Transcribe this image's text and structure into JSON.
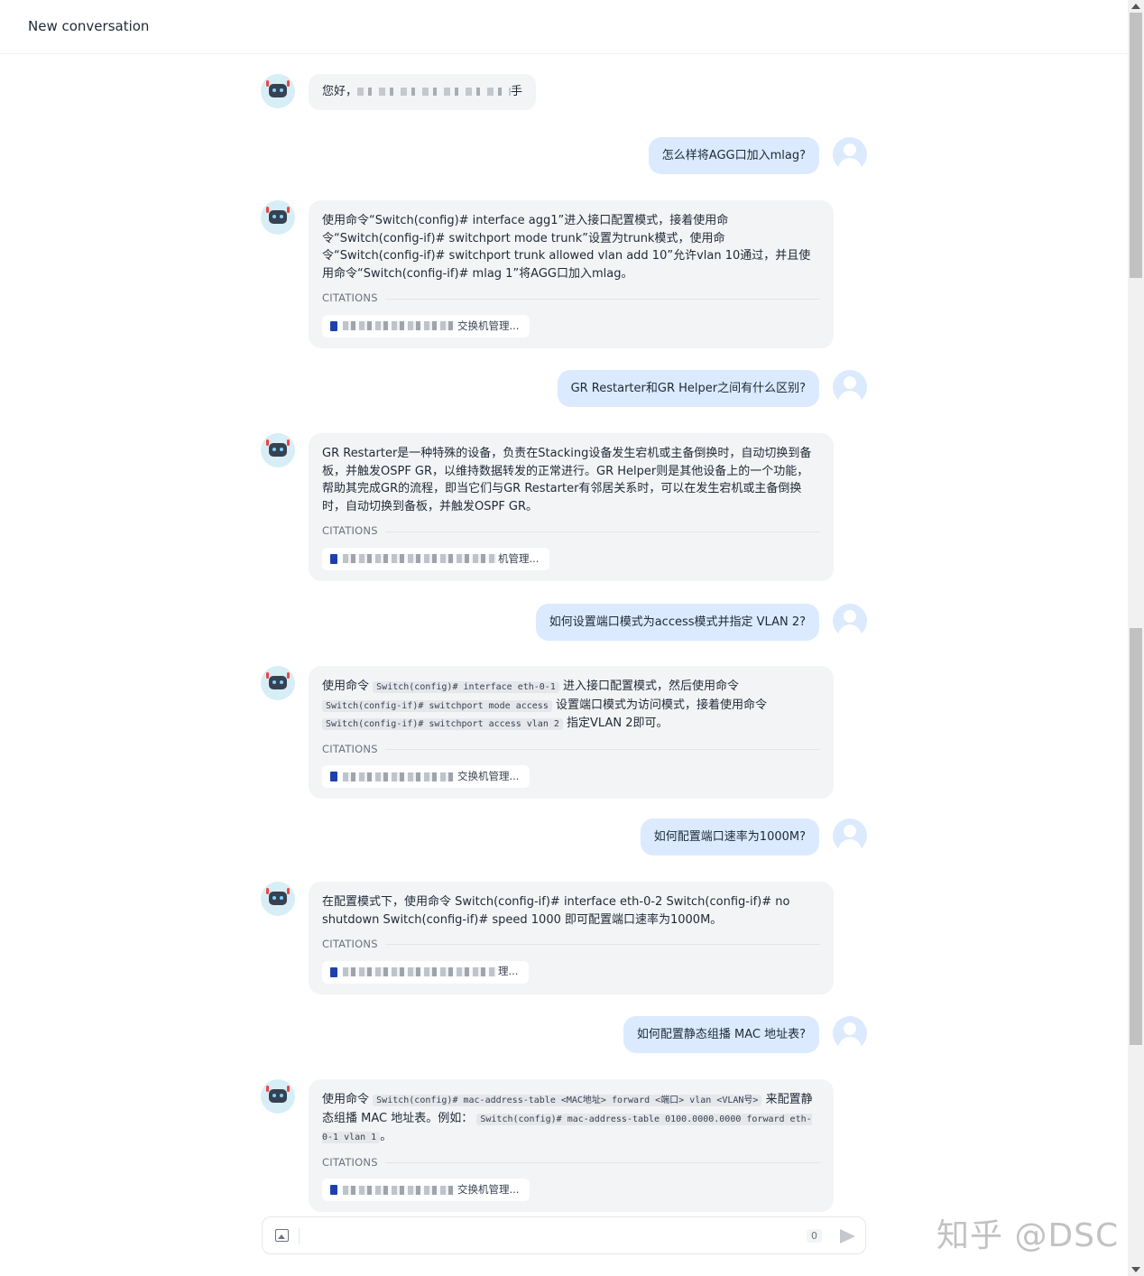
{
  "header": {
    "title": "New conversation"
  },
  "messages": [
    {
      "role": "bot",
      "text_visible_start": "您好，",
      "text_visible_end": "手"
    },
    {
      "role": "user",
      "text": "怎么样将AGG口加入mlag?"
    },
    {
      "role": "bot",
      "text": "使用命令“Switch(config)# interface agg1”进入接口配置模式，接着使用命令“Switch(config-if)# switchport mode trunk”设置为trunk模式，使用命令“Switch(config-if)# switchport trunk allowed vlan add 10”允许vlan 10通过，并且使用命令“Switch(config-if)# mlag 1”将AGG口加入mlag。",
      "citations_label": "CITATIONS",
      "citation": "交换机管理..."
    },
    {
      "role": "user",
      "text": "GR Restarter和GR Helper之间有什么区别?"
    },
    {
      "role": "bot",
      "text": "GR Restarter是一种特殊的设备，负责在Stacking设备发生宕机或主备倒换时，自动切换到备板，并触发OSPF GR，以维持数据转发的正常进行。GR Helper则是其他设备上的一个功能，帮助其完成GR的流程，即当它们与GR Restarter有邻居关系时，可以在发生宕机或主备倒换时，自动切换到备板，并触发OSPF GR。",
      "citations_label": "CITATIONS",
      "citation": "机管理..."
    },
    {
      "role": "user",
      "text": "如何设置端口模式为access模式并指定 VLAN 2?"
    },
    {
      "role": "bot",
      "parts": {
        "p1": "使用命令",
        "c1": "Switch(config)# interface eth-0-1",
        "p2": "进入接口配置模式，然后使用命令",
        "c2": "Switch(config-if)# switchport mode access",
        "p3": "设置端口模式为访问模式，接着使用命令",
        "c3": "Switch(config-if)# switchport access vlan 2",
        "p4": "指定VLAN 2即可。"
      },
      "citations_label": "CITATIONS",
      "citation": "交换机管理..."
    },
    {
      "role": "user",
      "text": "如何配置端口速率为1000M?"
    },
    {
      "role": "bot",
      "text": "在配置模式下，使用命令 Switch(config-if)# interface eth-0-2 Switch(config-if)# no shutdown Switch(config-if)# speed 1000 即可配置端口速率为1000M。",
      "citations_label": "CITATIONS",
      "citation": "理..."
    },
    {
      "role": "user",
      "text": "如何配置静态组播 MAC 地址表?"
    },
    {
      "role": "bot",
      "parts": {
        "p1": "使用命令",
        "c1": "Switch(config)# mac-address-table <MAC地址> forward <端口> vlan <VLAN号>",
        "p2": "来配置静态组播 MAC 地址表。例如：",
        "c2": "Switch(config)# mac-address-table 0100.0000.0000 forward eth-0-1 vlan 1",
        "p3": "。"
      },
      "citations_label": "CITATIONS",
      "citation": "交换机管理..."
    }
  ],
  "composer": {
    "counter": "0"
  },
  "watermark": "知乎 @DSC"
}
